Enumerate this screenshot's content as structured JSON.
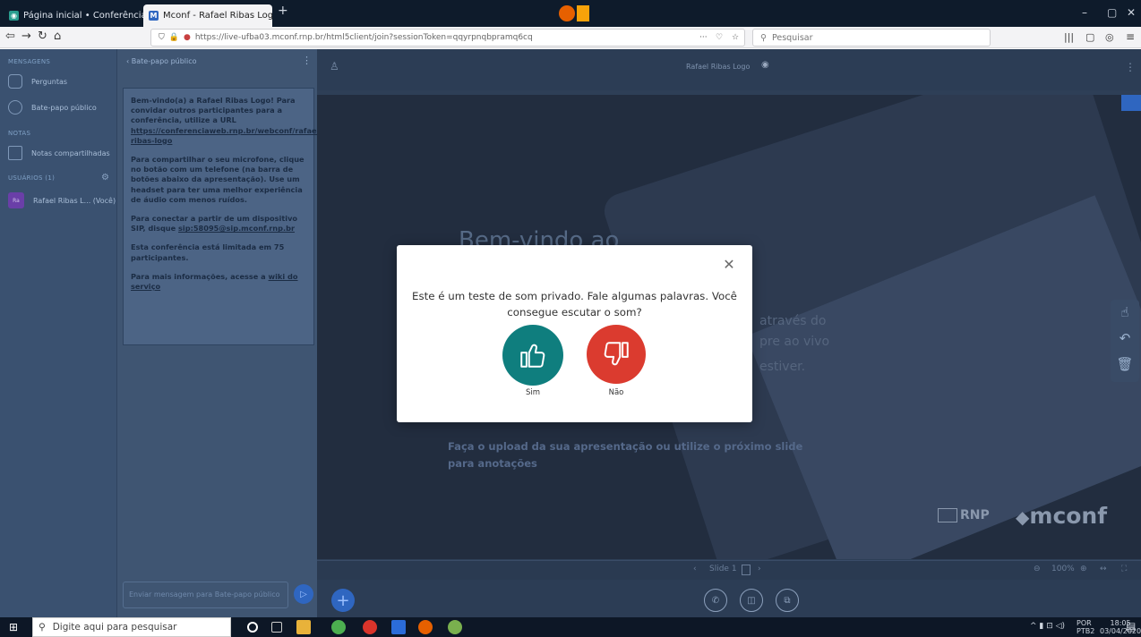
{
  "browser": {
    "tabs": [
      {
        "title": "Página inicial • Conferência W...",
        "close": "✕"
      },
      {
        "title": "Mconf - Rafael Ribas Logo",
        "close": "✕",
        "audio": "🔊"
      }
    ],
    "new_tab": "+",
    "window_controls": {
      "minimize": "–",
      "maximize": "▢",
      "close": "✕"
    },
    "url": "https://live-ufba03.mconf.rnp.br/html5client/join?sessionToken=qqyrpnqbpramq6cq",
    "url_host_bold": "rnp.br",
    "search_placeholder": "Pesquisar",
    "page_actions": "···"
  },
  "sidebar": {
    "mensagens_header": "MENSAGENS",
    "perguntas": "Perguntas",
    "bate_papo": "Bate-papo público",
    "notas_header": "NOTAS",
    "notas_compartilhadas": "Notas compartilhadas",
    "usuarios_header": "USUÁRIOS (1)",
    "user_name": "Rafael Ribas L... (Você)",
    "user_initials": "Ra"
  },
  "chat": {
    "header": "Bate-papo público",
    "welcome_p1_pre": "Bem-vindo(a) a ",
    "welcome_p1_room": "Rafael Ribas Logo",
    "welcome_p1_post": "! Para convidar outros participantes para a conferência, utilize a URL ",
    "welcome_p1_url": "https://conferenciaweb.rnp.br/webconf/rafael-ribas-logo",
    "welcome_p2": "Para compartilhar o seu microfone, clique no botão com um telefone (na barra de botões abaixo da apresentação). Use um headset para ter uma melhor experiência de áudio com menos ruídos.",
    "welcome_p3_pre": "Para conectar a partir de um dispositivo SIP, disque ",
    "welcome_p3_sip": "sip:58095@sip.mconf.rnp.br",
    "welcome_p4": "Esta conferência está limitada em 75 participantes.",
    "welcome_p5_pre": "Para mais informações, acesse a ",
    "welcome_p5_link": "wiki do serviço",
    "input_placeholder": "Enviar mensagem para Bate-papo público"
  },
  "presentation": {
    "meeting_title": "Rafael Ribas Logo",
    "slide_title": "Bem-vindo ao",
    "slide_upload_text": "Faça o upload da sua apresentação ou utilize o próximo slide para anotações",
    "slide_fragments": [
      "através do",
      "pre ao vivo",
      "estiver."
    ],
    "logo_rnp": "RNP",
    "logo_mconf": "mconf",
    "slide_nav": "Slide 1",
    "zoom": "100%"
  },
  "modal": {
    "message": "Este é um teste de som privado. Fale algumas palavras. Você consegue escutar o som?",
    "yes_label": "Sim",
    "no_label": "Não",
    "close": "✕"
  },
  "taskbar": {
    "search_placeholder": "Digite aqui para pesquisar",
    "lang": "POR",
    "lang_sub": "PTB2",
    "time": "18:05",
    "date": "03/04/2020"
  },
  "colors": {
    "yes_button": "#0f7e7e",
    "no_button": "#db3b2f",
    "accent_blue": "#2f66c0"
  }
}
